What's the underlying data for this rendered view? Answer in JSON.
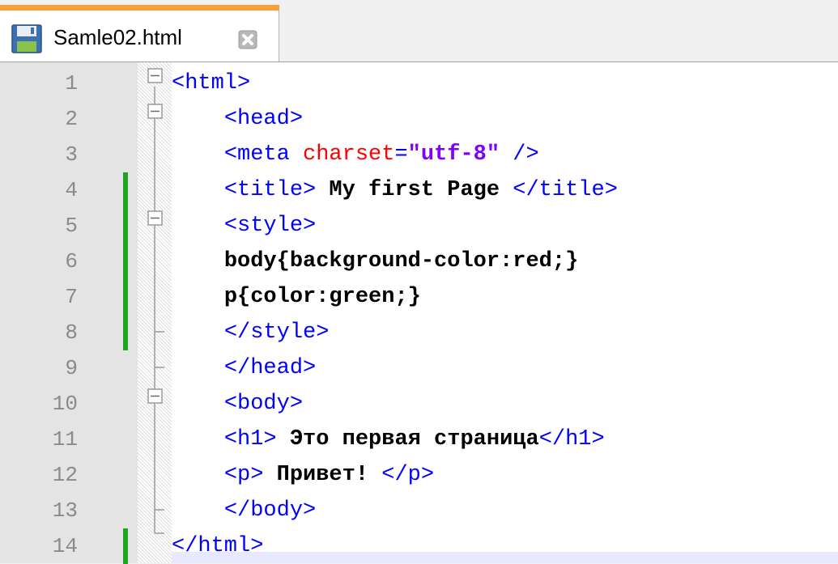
{
  "tab": {
    "title": "Samle02.html",
    "icon": "save-icon",
    "close_icon": "close-icon"
  },
  "colors": {
    "tab_accent": "#f7a13a",
    "change_marker": "#1fa51f",
    "tag": "#0000ff",
    "attribute": "#ff0000",
    "attribute_value": "#8000ff"
  },
  "lines": [
    {
      "num": "1",
      "ind": "",
      "parts": [
        {
          "t": "<html>",
          "c": "tag"
        }
      ]
    },
    {
      "num": "2",
      "ind": "    ",
      "parts": [
        {
          "t": "<head>",
          "c": "tag"
        }
      ]
    },
    {
      "num": "3",
      "ind": "    ",
      "parts": [
        {
          "t": "<meta ",
          "c": "tag"
        },
        {
          "t": "charset",
          "c": "attr"
        },
        {
          "t": "=",
          "c": "tag"
        },
        {
          "t": "\"utf-8\"",
          "c": "val"
        },
        {
          "t": " />",
          "c": "tag"
        }
      ]
    },
    {
      "num": "4",
      "ind": "    ",
      "parts": [
        {
          "t": "<title>",
          "c": "tag"
        },
        {
          "t": " My first Page ",
          "c": "txt"
        },
        {
          "t": "</title>",
          "c": "tag"
        }
      ]
    },
    {
      "num": "5",
      "ind": "    ",
      "parts": [
        {
          "t": "<style>",
          "c": "tag"
        }
      ]
    },
    {
      "num": "6",
      "ind": "    ",
      "parts": [
        {
          "t": "body{background-color:red;}",
          "c": "txt"
        }
      ]
    },
    {
      "num": "7",
      "ind": "    ",
      "parts": [
        {
          "t": "p{color:green;}",
          "c": "txt"
        }
      ]
    },
    {
      "num": "8",
      "ind": "    ",
      "parts": [
        {
          "t": "</style>",
          "c": "tag"
        }
      ]
    },
    {
      "num": "9",
      "ind": "    ",
      "parts": [
        {
          "t": "</head>",
          "c": "tag"
        }
      ]
    },
    {
      "num": "10",
      "ind": "    ",
      "parts": [
        {
          "t": "<body>",
          "c": "tag"
        }
      ]
    },
    {
      "num": "11",
      "ind": "    ",
      "parts": [
        {
          "t": "<h1>",
          "c": "tag"
        },
        {
          "t": " Это первая страница",
          "c": "txt"
        },
        {
          "t": "</h1>",
          "c": "tag"
        }
      ]
    },
    {
      "num": "12",
      "ind": "    ",
      "parts": [
        {
          "t": "<p>",
          "c": "tag"
        },
        {
          "t": " Привет! ",
          "c": "txt"
        },
        {
          "t": "</p>",
          "c": "tag"
        }
      ]
    },
    {
      "num": "13",
      "ind": "    ",
      "parts": [
        {
          "t": "</body>",
          "c": "tag"
        }
      ]
    },
    {
      "num": "14",
      "ind": "",
      "parts": [
        {
          "t": "</html>",
          "c": "tag"
        }
      ]
    }
  ],
  "changed_lines": [
    "4",
    "5",
    "6",
    "7",
    "8",
    "14"
  ]
}
